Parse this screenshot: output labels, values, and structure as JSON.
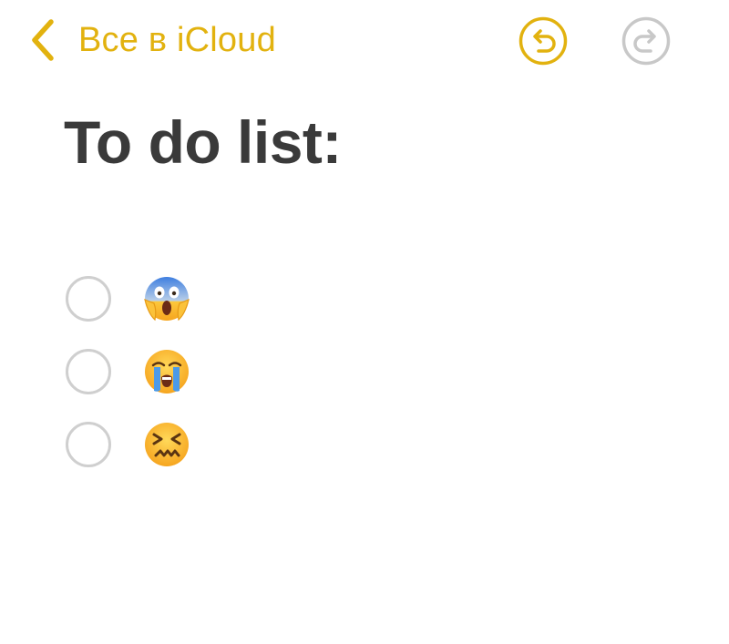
{
  "nav": {
    "back_label": "Все в iCloud",
    "back_icon": "chevron-left-icon",
    "undo_icon": "undo-icon",
    "redo_icon": "redo-icon"
  },
  "note": {
    "title": "To do list:",
    "items": [
      {
        "checked": false,
        "emoji": "face-screaming-in-fear"
      },
      {
        "checked": false,
        "emoji": "loudly-crying-face"
      },
      {
        "checked": false,
        "emoji": "confounded-face"
      }
    ]
  },
  "colors": {
    "accent": "#e2b20f",
    "disabled": "#c8c8c8",
    "title": "#3a3a3a",
    "checkbox_border": "#cfcfcf"
  }
}
